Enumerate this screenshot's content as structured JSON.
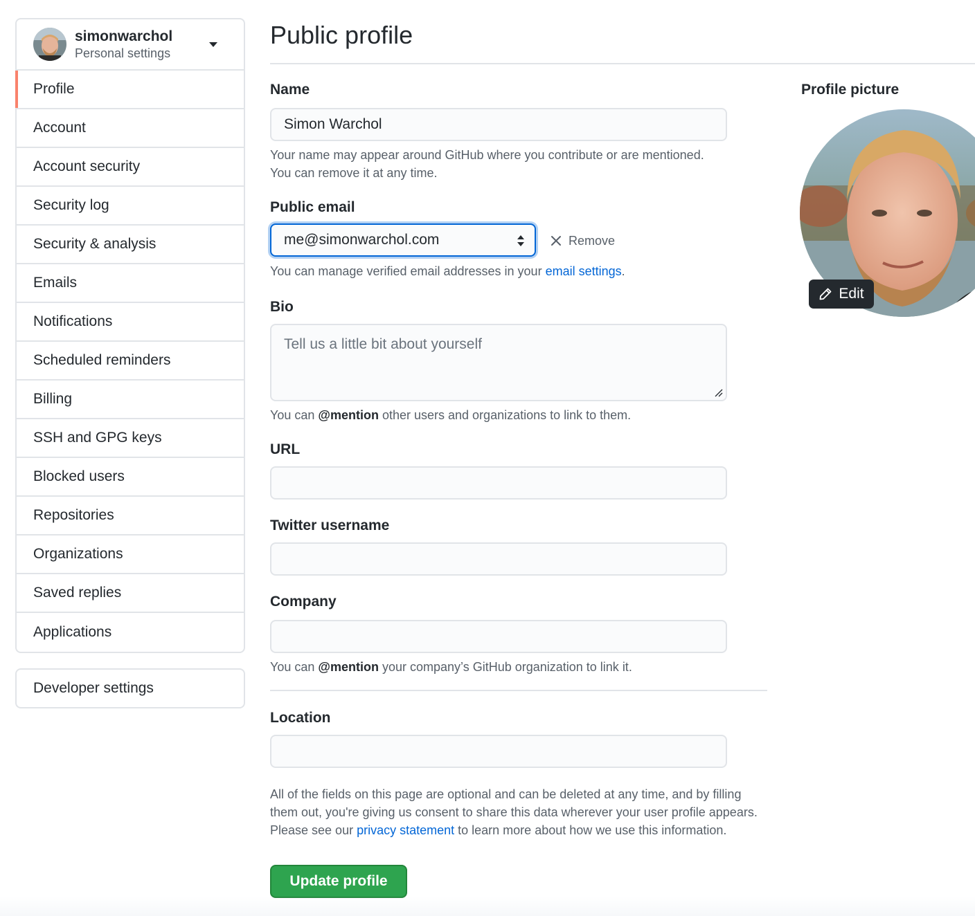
{
  "sidebar": {
    "username": "simonwarchol",
    "subtitle": "Personal settings",
    "items": [
      {
        "label": "Profile"
      },
      {
        "label": "Account"
      },
      {
        "label": "Account security"
      },
      {
        "label": "Security log"
      },
      {
        "label": "Security & analysis"
      },
      {
        "label": "Emails"
      },
      {
        "label": "Notifications"
      },
      {
        "label": "Scheduled reminders"
      },
      {
        "label": "Billing"
      },
      {
        "label": "SSH and GPG keys"
      },
      {
        "label": "Blocked users"
      },
      {
        "label": "Repositories"
      },
      {
        "label": "Organizations"
      },
      {
        "label": "Saved replies"
      },
      {
        "label": "Applications"
      }
    ],
    "selected": "Profile",
    "developer_settings": "Developer settings"
  },
  "main": {
    "title": "Public profile",
    "name": {
      "label": "Name",
      "value": "Simon Warchol",
      "note_line1": "Your name may appear around GitHub where you contribute or are mentioned.",
      "note_line2": "You can remove it at any time."
    },
    "public_email": {
      "label": "Public email",
      "selected": "me@simonwarchol.com",
      "remove_label": "Remove",
      "note_prefix": "You can manage verified email addresses in your ",
      "note_link": "email settings",
      "note_suffix": "."
    },
    "bio": {
      "label": "Bio",
      "placeholder": "Tell us a little bit about yourself",
      "note_prefix": "You can ",
      "note_bold": "@mention",
      "note_suffix": " other users and organizations to link to them."
    },
    "url": {
      "label": "URL",
      "value": ""
    },
    "twitter": {
      "label": "Twitter username",
      "value": ""
    },
    "company": {
      "label": "Company",
      "value": "",
      "note_prefix": "You can ",
      "note_bold": "@mention",
      "note_suffix": " your company’s GitHub organization to link it."
    },
    "location": {
      "label": "Location",
      "value": ""
    },
    "disclaimer": {
      "part1": "All of the fields on this page are optional and can be deleted at any time, and by filling them out, you're giving us consent to share this data wherever your user profile appears. Please see our ",
      "link": "privacy statement",
      "part2": " to learn more about how we use this information."
    },
    "update_button": "Update profile"
  },
  "profile_picture": {
    "label": "Profile picture",
    "edit_label": "Edit"
  },
  "colors": {
    "accent_link": "#0366d6",
    "selected_marker": "#f9826c",
    "primary_button": "#2ea44f",
    "border": "#e1e4e8"
  },
  "icons": [
    "chevron-down-icon",
    "close-icon",
    "pencil-icon",
    "select-arrows-icon",
    "resize-grip-icon"
  ]
}
